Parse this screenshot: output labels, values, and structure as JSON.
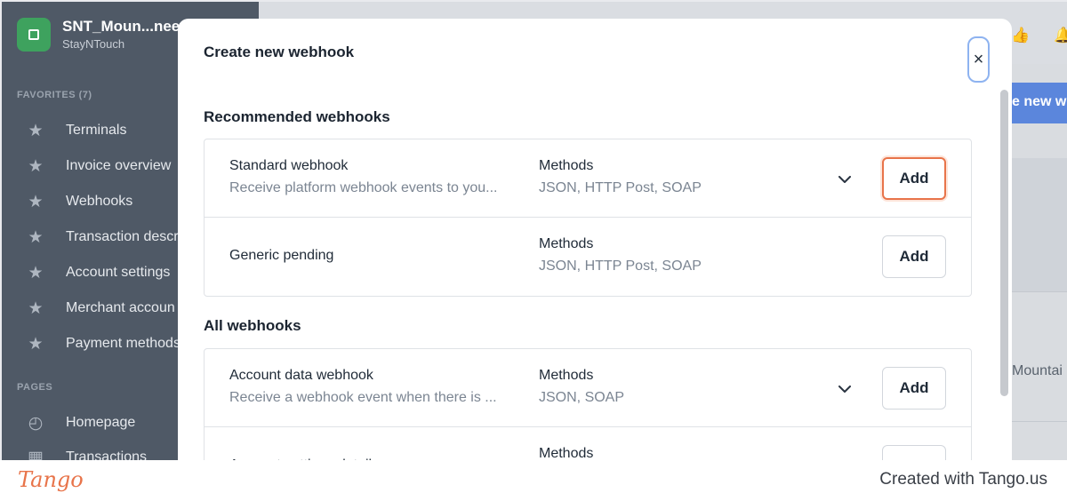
{
  "sidebar": {
    "org_name": "SNT_Moun...nee",
    "org_sub": "StayNTouch",
    "favorites_label": "FAVORITES (7)",
    "pages_label": "PAGES",
    "favorites": [
      {
        "label": "Terminals",
        "icon": "star-icon"
      },
      {
        "label": "Invoice overview",
        "icon": "star-icon"
      },
      {
        "label": "Webhooks",
        "icon": "star-icon"
      },
      {
        "label": "Transaction descr",
        "icon": "star-icon"
      },
      {
        "label": "Account settings",
        "icon": "star-icon"
      },
      {
        "label": "Merchant accoun",
        "icon": "star-icon"
      },
      {
        "label": "Payment methods",
        "icon": "star-icon"
      }
    ],
    "pages": [
      {
        "label": "Homepage",
        "icon": "gauge-icon"
      },
      {
        "label": "Transactions",
        "icon": "table-icon"
      }
    ]
  },
  "background": {
    "blue_button_text": "e new w",
    "mountain_text": "Mountai"
  },
  "modal": {
    "title": "Create new webhook",
    "close_glyph": "×",
    "recommended_title": "Recommended webhooks",
    "all_title": "All webhooks",
    "methods_label": "Methods",
    "add_label": "Add",
    "recommended": [
      {
        "name": "Standard webhook",
        "desc": "Receive platform webhook events to you...",
        "methods": "JSON, HTTP Post, SOAP",
        "expandable": true,
        "focused": true
      },
      {
        "name": "Generic pending",
        "desc": "",
        "methods": "JSON, HTTP Post, SOAP",
        "expandable": false,
        "focused": false
      }
    ],
    "all": [
      {
        "name": "Account data webhook",
        "desc": "Receive a webhook event when there is ...",
        "methods": "JSON, SOAP",
        "expandable": true,
        "focused": false
      },
      {
        "name": "Account settings details",
        "desc": "",
        "methods": "",
        "expandable": false,
        "focused": false
      }
    ]
  },
  "footer": {
    "logo_text": "Tango",
    "credit": "Created with Tango.us"
  },
  "colors": {
    "sidebar_bg": "#4f5966",
    "accent_orange": "#e8744a",
    "close_focus": "#8eb3f0"
  }
}
